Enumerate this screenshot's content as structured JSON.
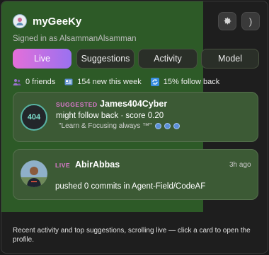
{
  "app": {
    "title": "myGeeKy",
    "signed_in_text": "Signed in as AlsammanAlsamman",
    "collapse_glyph": ")"
  },
  "icons": {
    "avatar": "user-avatar",
    "settings": "gear-icon",
    "collapse": "chevron-right-icon",
    "friends": "people-icon",
    "new_this_week": "news-icon",
    "follow_back": "refresh-icon"
  },
  "tabs": [
    {
      "label": "Live",
      "active": true
    },
    {
      "label": "Suggestions",
      "active": false
    },
    {
      "label": "Activity",
      "active": false
    },
    {
      "label": "Model",
      "active": false
    }
  ],
  "stats": {
    "friends": "0 friends",
    "new_this_week": "154 new this week",
    "follow_back": "15% follow back"
  },
  "cards": [
    {
      "badge": "SUGGESTED",
      "avatar_text": "404",
      "name": "James404Cyber",
      "line": "might follow back · score 0.20",
      "quote": "\"Learn & Focusing always ™\""
    },
    {
      "badge": "LIVE",
      "name": "AbirAbbas",
      "time": "3h ago",
      "line": "pushed 0 commits in Agent-Field/CodeAF"
    }
  ],
  "footer": "Recent activity and top suggestions, scrolling live — click a card to open the profile.",
  "colors": {
    "accent_gradient_start": "#e46fd9",
    "accent_gradient_end": "#9a71f0",
    "panel_green": "#2d5a27",
    "card_green": "#3c5a35",
    "badge_pink": "#e07ad2"
  }
}
